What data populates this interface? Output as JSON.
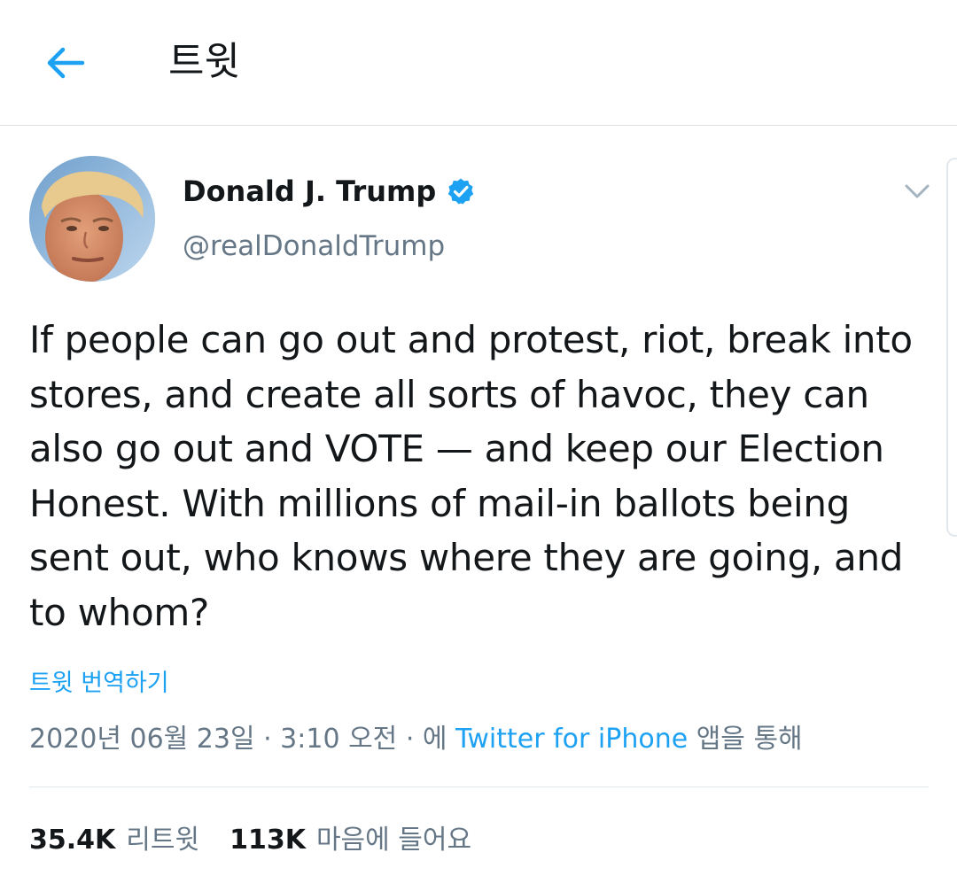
{
  "header": {
    "back_icon": "arrow-left-icon",
    "title": "트윗"
  },
  "colors": {
    "accent": "#1da1f2",
    "text_primary": "#14171a",
    "text_secondary": "#657786",
    "divider": "#e1e8ed"
  },
  "tweet": {
    "author": {
      "name": "Donald J. Trump",
      "handle": "@realDonaldTrump",
      "verified_icon": "verified-badge-icon"
    },
    "menu_icon": "chevron-down-icon",
    "text": "If people can go out and protest, riot, break into\nstores, and create all sorts of havoc, they can\nalso go out and VOTE — and keep our Election\nHonest. With millions of mail-in ballots being\nsent out, who knows where they are going, and\nto whom?",
    "translate_label": "트윗 번역하기",
    "meta": {
      "datetime": "2020년 06월 23일 · 3:10 오전 · 에 ",
      "source": "Twitter for iPhone",
      "suffix": " 앱을 통해"
    },
    "stats": {
      "retweets_count": "35.4K",
      "retweets_label": "리트윗",
      "likes_count": "113K",
      "likes_label": "마음에 들어요"
    }
  }
}
